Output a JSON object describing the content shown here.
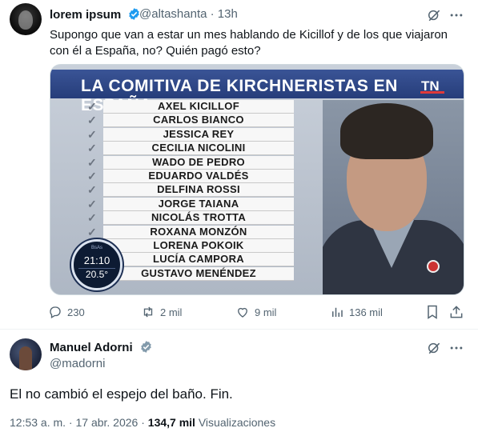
{
  "tweet": {
    "author_name": "lorem ipsum",
    "handle": "@altashanta",
    "separator": "·",
    "time": "13h",
    "text": "Supongo que van a estar un mes hablando de Kicillof y de los que viajaron con él a España, no? Quién pagó esto?",
    "media": {
      "banner": "LA COMITIVA DE KIRCHNERISTAS EN ESPAÑA",
      "names": [
        "AXEL KICILLOF",
        "CARLOS BIANCO",
        "JESSICA REY",
        "CECILIA NICOLINI",
        "WADO DE PEDRO",
        "EDUARDO VALDÉS",
        "DELFINA ROSSI",
        "JORGE TAIANA",
        "NICOLÁS TROTTA",
        "ROXANA MONZÓN",
        "LORENA POKOIK",
        "LUCÍA CAMPORA",
        "GUSTAVO MENÉNDEZ"
      ],
      "clock_time": "21:10",
      "clock_temp": "20.5°",
      "clock_small": "BsAs"
    },
    "stats": {
      "replies": "230",
      "retweets": "2 mil",
      "likes": "9 mil",
      "views": "136 mil"
    }
  },
  "reply": {
    "author_name": "Manuel Adorni",
    "handle": "@madorni",
    "text": "El no cambió el espejo del baño. Fin.",
    "timestamp": "12:53 a. m. · 17 abr. 2026",
    "separator": " · ",
    "views_count": "134,7 mil",
    "views_label": " Visualizaciones"
  },
  "icons": [
    "grok-icon",
    "more-icon",
    "reply-icon",
    "retweet-icon",
    "like-icon",
    "views-icon",
    "bookmark-icon",
    "share-icon",
    "verified-badge-icon"
  ],
  "colors": {
    "verified": "#1d9bf0",
    "secondary_text": "#536471",
    "banner_blue": "#2a437f"
  }
}
